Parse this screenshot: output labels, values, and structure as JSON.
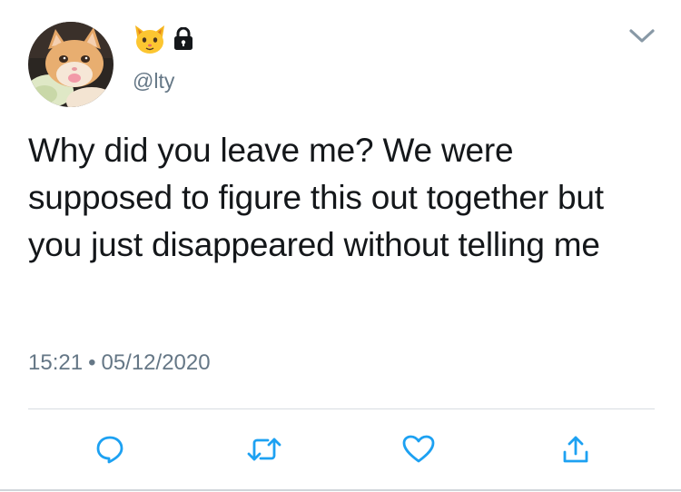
{
  "tweet": {
    "display_name_icons": [
      "cat-face-emoji",
      "lock-icon"
    ],
    "handle": "@lty",
    "text": "Why did you leave me? We were supposed to figure this out together but you just disappeared without telling me",
    "time": "15:21",
    "separator": "•",
    "date": "05/12/2020"
  },
  "actions": [
    "reply-icon",
    "retweet-icon",
    "like-icon",
    "share-icon"
  ],
  "colors": {
    "text": "#14171a",
    "secondary": "#657786",
    "icon": "#1da1f2",
    "divider": "#d8dde1"
  }
}
